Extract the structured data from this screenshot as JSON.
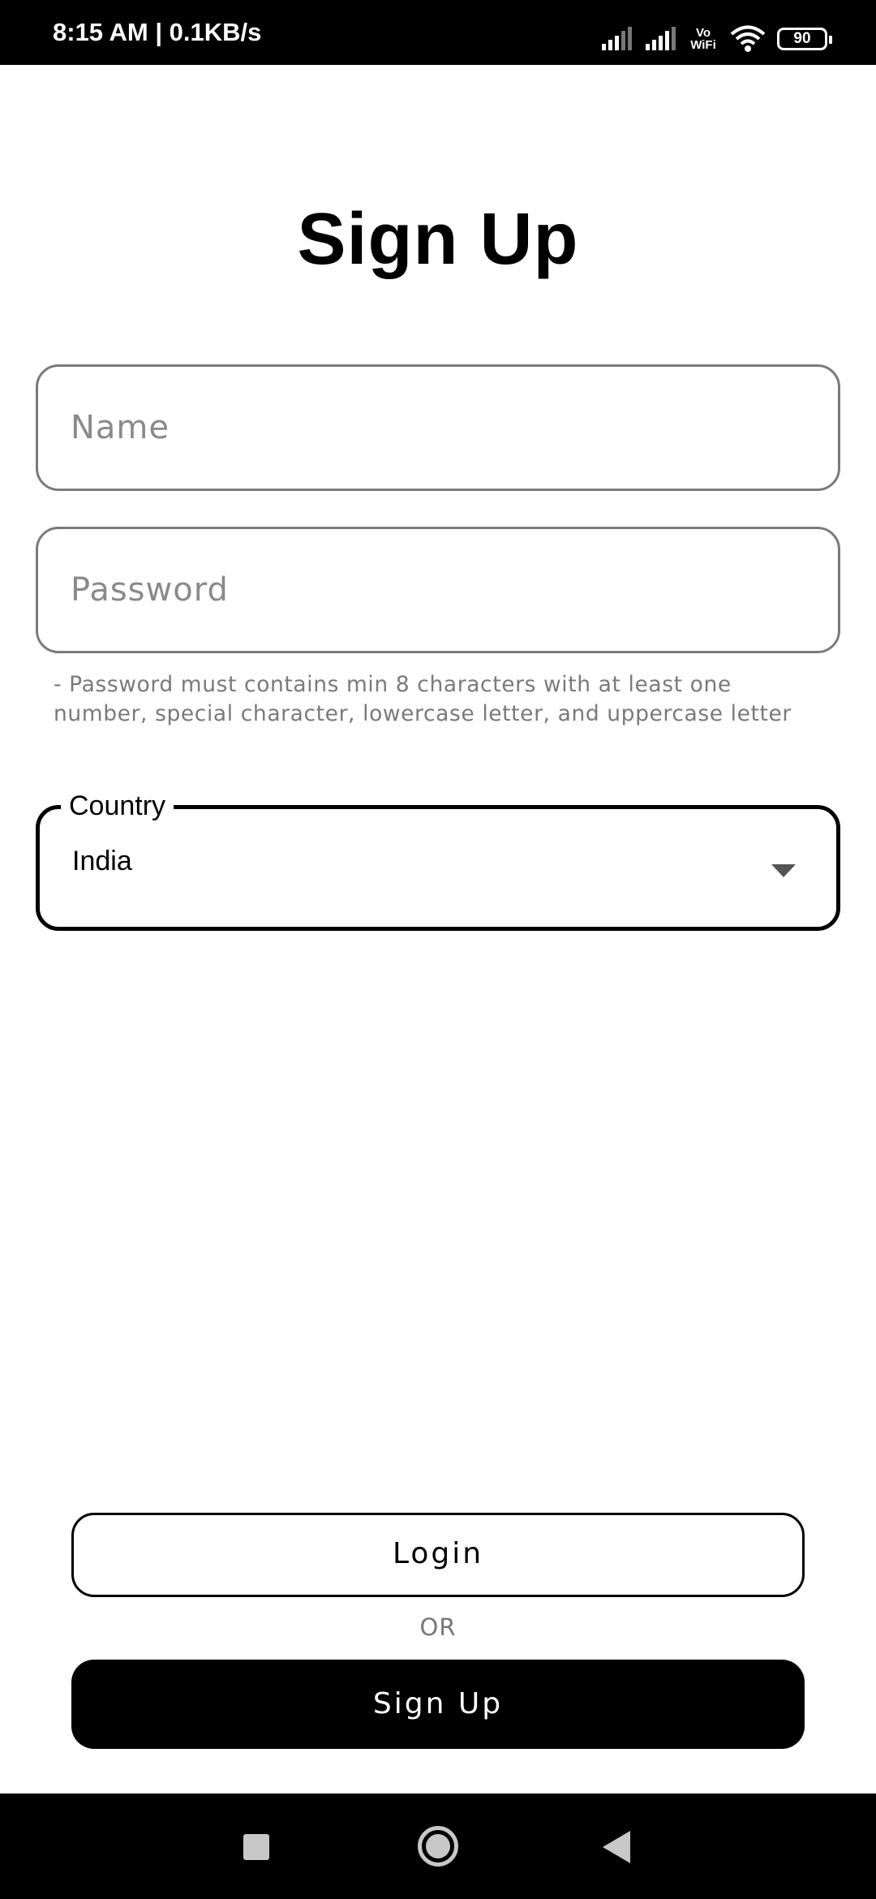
{
  "status_bar": {
    "time_speed": "8:15 AM | 0.1KB/s",
    "vowifi_top": "Vo",
    "vowifi_bottom": "WiFi",
    "battery_level": "90",
    "icons": [
      "signal-icon",
      "signal-icon",
      "vowifi-icon",
      "wifi-icon",
      "battery-icon"
    ]
  },
  "page": {
    "title": "Sign Up"
  },
  "form": {
    "name_placeholder": "Name",
    "name_value": "",
    "password_placeholder": "Password",
    "password_value": "",
    "password_hint": "- Password must contains min 8 characters with at least one number, special character, lowercase letter, and uppercase letter",
    "country_label": "Country",
    "country_value": "India"
  },
  "actions": {
    "login_label": "Login",
    "or_label": "OR",
    "signup_label": "Sign Up"
  },
  "nav_bar": {
    "icons": [
      "recents-icon",
      "home-icon",
      "back-icon"
    ]
  },
  "colors": {
    "background": "#ffffff",
    "status_bar": "#000000",
    "primary_button": "#000000",
    "field_border": "#7a7a7a",
    "hint_text": "#7a7a7a"
  }
}
